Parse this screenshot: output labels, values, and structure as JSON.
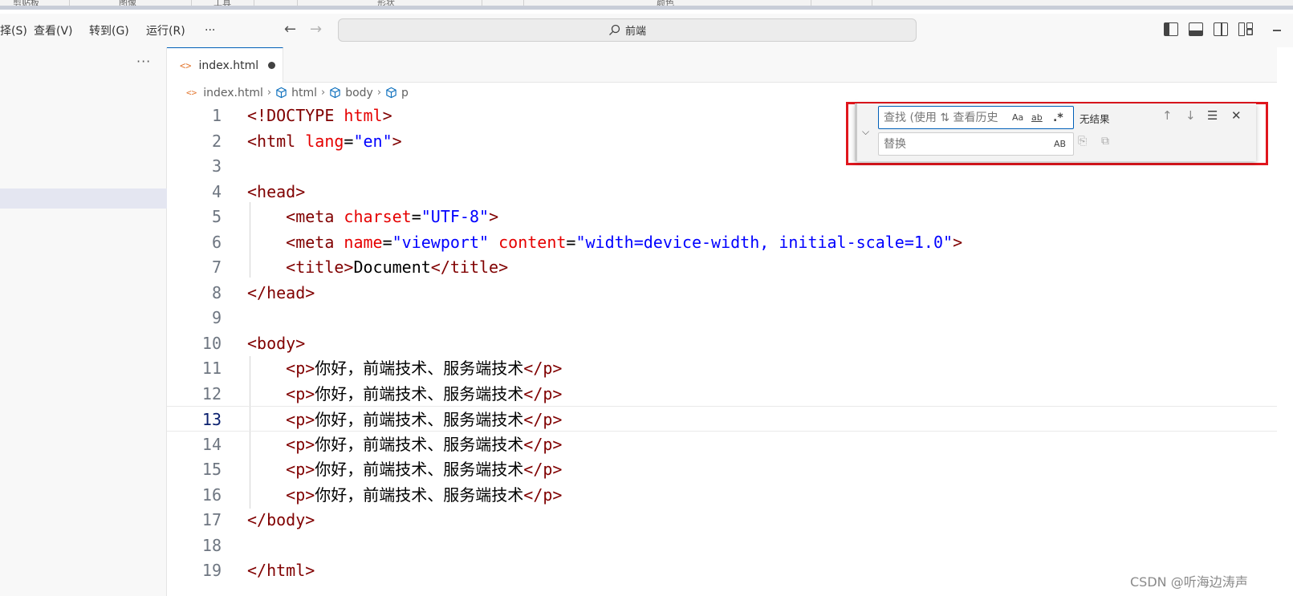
{
  "ribbon": {
    "groups": [
      "剪贴板",
      "图像",
      "工具",
      "形状",
      "颜色"
    ]
  },
  "menu": {
    "items": [
      "择(S)",
      "查看(V)",
      "转到(G)",
      "运行(R)",
      "···"
    ]
  },
  "command_center": {
    "text": "前端"
  },
  "sidebar": {
    "more_label": "···"
  },
  "tab": {
    "icon": "<>",
    "label": "index.html"
  },
  "breadcrumb": {
    "file_icon": "<>",
    "items": [
      "index.html",
      "html",
      "body",
      "p"
    ]
  },
  "editor": {
    "lines": [
      [
        [
          "<!DOCTYPE ",
          "tag"
        ],
        [
          "html",
          "attr"
        ],
        [
          ">",
          "tag"
        ]
      ],
      [
        [
          "<html ",
          "tag"
        ],
        [
          "lang",
          "attr"
        ],
        [
          "=",
          "pl"
        ],
        [
          "\"en\"",
          "str"
        ],
        [
          ">",
          "tag"
        ]
      ],
      [],
      [
        [
          "<head>",
          "tag"
        ]
      ],
      [
        [
          "    ",
          "pl"
        ],
        [
          "<meta ",
          "tag"
        ],
        [
          "charset",
          "attr"
        ],
        [
          "=",
          "pl"
        ],
        [
          "\"UTF-8\"",
          "str"
        ],
        [
          ">",
          "tag"
        ]
      ],
      [
        [
          "    ",
          "pl"
        ],
        [
          "<meta ",
          "tag"
        ],
        [
          "name",
          "attr"
        ],
        [
          "=",
          "pl"
        ],
        [
          "\"viewport\"",
          "str"
        ],
        [
          " ",
          "pl"
        ],
        [
          "content",
          "attr"
        ],
        [
          "=",
          "pl"
        ],
        [
          "\"width=device-width, initial-scale=1.0\"",
          "str"
        ],
        [
          ">",
          "tag"
        ]
      ],
      [
        [
          "    ",
          "pl"
        ],
        [
          "<title>",
          "tag"
        ],
        [
          "Document",
          "txt"
        ],
        [
          "</title>",
          "tag"
        ]
      ],
      [
        [
          "</head>",
          "tag"
        ]
      ],
      [],
      [
        [
          "<body>",
          "tag"
        ]
      ],
      [
        [
          "    ",
          "pl"
        ],
        [
          "<p>",
          "tag"
        ],
        [
          "你好，前端技术、服务端技术",
          "txt"
        ],
        [
          "</p>",
          "tag"
        ]
      ],
      [
        [
          "    ",
          "pl"
        ],
        [
          "<p>",
          "tag"
        ],
        [
          "你好，前端技术、服务端技术",
          "txt"
        ],
        [
          "</p>",
          "tag"
        ]
      ],
      [
        [
          "    ",
          "pl"
        ],
        [
          "<p>",
          "tag"
        ],
        [
          "你好，前端技术、服务端技术",
          "txt"
        ],
        [
          "</p>",
          "tag"
        ]
      ],
      [
        [
          "    ",
          "pl"
        ],
        [
          "<p>",
          "tag"
        ],
        [
          "你好，前端技术、服务端技术",
          "txt"
        ],
        [
          "</p>",
          "tag"
        ]
      ],
      [
        [
          "    ",
          "pl"
        ],
        [
          "<p>",
          "tag"
        ],
        [
          "你好，前端技术、服务端技术",
          "txt"
        ],
        [
          "</p>",
          "tag"
        ]
      ],
      [
        [
          "    ",
          "pl"
        ],
        [
          "<p>",
          "tag"
        ],
        [
          "你好，前端技术、服务端技术",
          "txt"
        ],
        [
          "</p>",
          "tag"
        ]
      ],
      [
        [
          "</body>",
          "tag"
        ]
      ],
      [],
      [
        [
          "</html>",
          "tag"
        ]
      ]
    ],
    "current_line": 13
  },
  "find_widget": {
    "find_placeholder": "查找 (使用 ⇅ 查看历史",
    "replace_placeholder": "替换",
    "match_case_label": "Aa",
    "whole_word_label": "ab",
    "regex_label": ".*",
    "preserve_case_label": "AB",
    "result_text": "无结果"
  },
  "watermark": {
    "text": "CSDN @听海边涛声"
  }
}
